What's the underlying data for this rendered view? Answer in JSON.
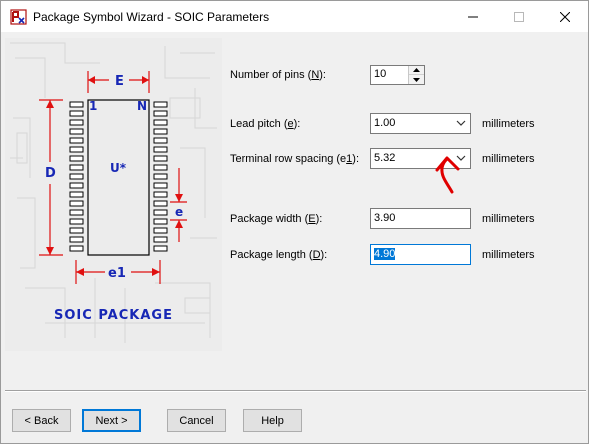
{
  "window": {
    "title": "Package Symbol Wizard - SOIC Parameters",
    "controls": {
      "minimize": "minimize-icon",
      "maximize": "maximize-icon",
      "close": "close-icon"
    }
  },
  "diagram": {
    "dim_E": "E",
    "dim_D": "D",
    "dim_e": "e",
    "dim_e1": "e1",
    "pin_first": "1",
    "pin_last": "N",
    "ref_designator": "U*",
    "caption": "SOIC PACKAGE",
    "colors": {
      "dimension": "#e01010",
      "label": "#1727b5",
      "pins": "#000000"
    }
  },
  "fields": {
    "num_pins": {
      "label_pre": "Number of pins (",
      "label_u": "N",
      "label_post": "):",
      "value": "10"
    },
    "lead_pitch": {
      "label_pre": "Lead pitch (",
      "label_u": "e",
      "label_post": "):",
      "value": "1.00",
      "unit": "millimeters"
    },
    "row_spacing": {
      "label_pre": "Terminal row spacing (e",
      "label_u": "1",
      "label_post": "):",
      "value": "5.32",
      "unit": "millimeters"
    },
    "pkg_width": {
      "label_pre": "Package width (",
      "label_u": "E",
      "label_post": "):",
      "value": "3.90",
      "unit": "millimeters"
    },
    "pkg_length": {
      "label_pre": "Package length (",
      "label_u": "D",
      "label_post": "):",
      "value": "4.90",
      "unit": "millimeters"
    }
  },
  "buttons": {
    "back": "< Back",
    "next": "Next >",
    "cancel": "Cancel",
    "help": "Help"
  }
}
